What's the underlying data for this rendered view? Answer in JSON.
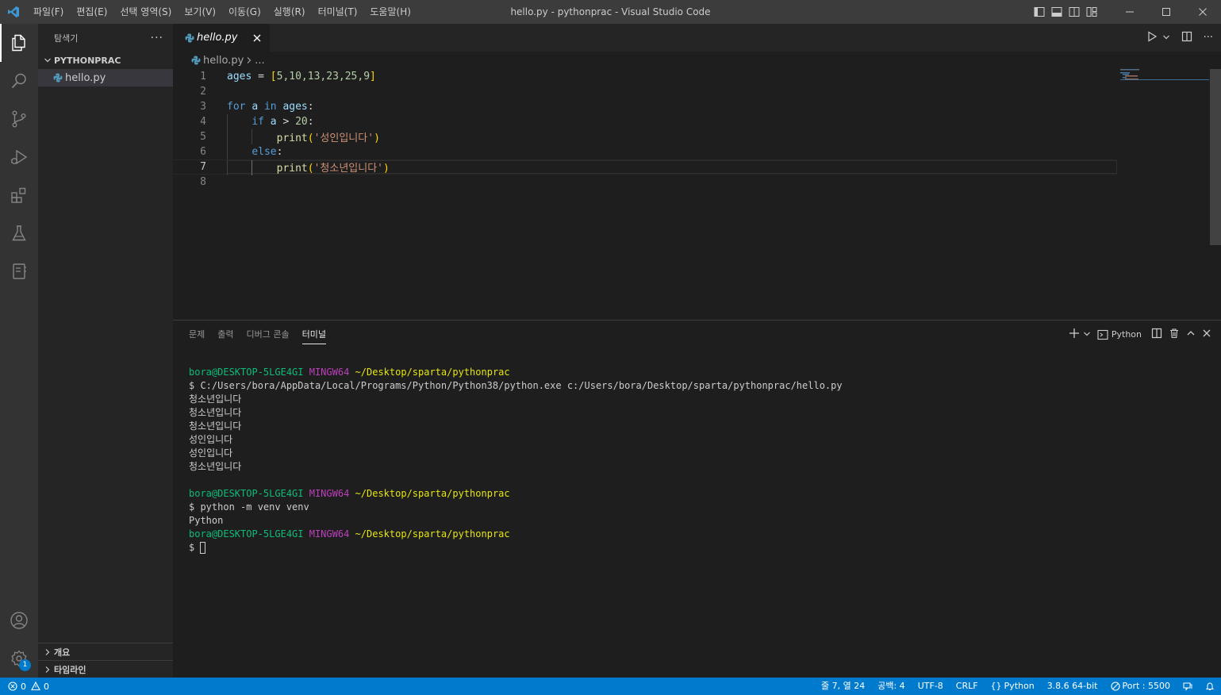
{
  "window": {
    "title": "hello.py - pythonprac - Visual Studio Code"
  },
  "menu": [
    "파일(F)",
    "편집(E)",
    "선택 영역(S)",
    "보기(V)",
    "이동(G)",
    "실행(R)",
    "터미널(T)",
    "도움말(H)"
  ],
  "colors": {
    "accent": "#007acc",
    "vscode_blue": "#3c99d4",
    "python_icon": "#519aba"
  },
  "activity_bar": {
    "items": [
      "files-icon",
      "search-icon",
      "source-control-icon",
      "run-debug-icon",
      "extensions-icon",
      "testing-icon",
      "notebook-icon"
    ],
    "bottom": [
      "account-icon",
      "manage-gear-icon"
    ],
    "manage_badge": "1"
  },
  "sidebar": {
    "title": "탐색기",
    "more": "···",
    "folder": "PYTHONPRAC",
    "files": [
      "hello.py"
    ],
    "bottom_sections": [
      "개요",
      "타임라인"
    ]
  },
  "editor": {
    "tab_label": "hello.py",
    "breadcrumb_file": "hello.py",
    "breadcrumb_more": "...",
    "line_numbers": [
      "1",
      "2",
      "3",
      "4",
      "5",
      "6",
      "7",
      "8"
    ],
    "current_line": "7",
    "code": {
      "l1_var": "ages",
      "l1_op": " = ",
      "l1_open": "[",
      "l1_vals": "5,10,13,23,25,9",
      "l1_close": "]",
      "l3_for": "for",
      "l3_a": "a",
      "l3_in": "in",
      "l3_ages": "ages",
      "l3_colon": ":",
      "l4_if": "if",
      "l4_a": "a",
      "l4_gt": " > ",
      "l4_num": "20",
      "l4_colon": ":",
      "l5_fn": "print",
      "l5_open": "(",
      "l5_str": "'성인입니다'",
      "l5_close": ")",
      "l6_else": "else",
      "l6_colon": ":",
      "l7_fn": "print",
      "l7_open": "(",
      "l7_str": "'청소년입니다'",
      "l7_close": ")"
    }
  },
  "panel": {
    "tabs": [
      "문제",
      "출력",
      "디버그 콘솔",
      "터미널"
    ],
    "active_tab": "터미널",
    "terminal_name": "Python",
    "prompt": {
      "user": "bora@DESKTOP-5LGE4GI",
      "shell": "MINGW64",
      "path": "~/Desktop/sparta/pythonprac"
    },
    "command1": "$ C:/Users/bora/AppData/Local/Programs/Python/Python38/python.exe c:/Users/bora/Desktop/sparta/pythonprac/hello.py",
    "output1": [
      "청소년입니다",
      "청소년입니다",
      "청소년입니다",
      "성인입니다",
      "성인입니다",
      "청소년입니다"
    ],
    "command2": "$ python -m venv venv",
    "output2": "Python",
    "final_prompt_symbol": "$ "
  },
  "statusbar": {
    "errors": "0",
    "warnings": "0",
    "position": "줄 7, 열 24",
    "spaces": "공백: 4",
    "encoding": "UTF-8",
    "eol": "CRLF",
    "language": "Python",
    "interpreter": "3.8.6 64-bit",
    "port": "Port : 5500"
  }
}
